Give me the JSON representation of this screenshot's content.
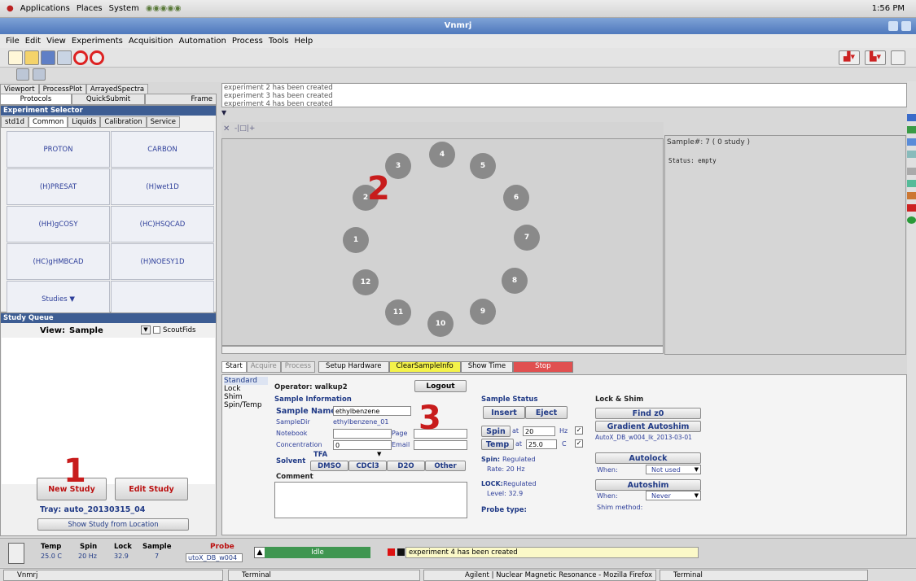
{
  "gnome": {
    "apps": "Applications",
    "places": "Places",
    "system": "System",
    "clock": "1:56 PM"
  },
  "window": {
    "title": "Vnmrj"
  },
  "menu": [
    "File",
    "Edit",
    "View",
    "Experiments",
    "Acquisition",
    "Automation",
    "Process",
    "Tools",
    "Help"
  ],
  "leftTabs": {
    "viewport": "Viewport",
    "processPlot": "ProcessPlot",
    "arrayedSpectra": "ArrayedSpectra",
    "protocols": "Protocols",
    "quickSubmit": "QuickSubmit",
    "frame": "Frame"
  },
  "expSelector": {
    "title": "Experiment Selector",
    "tabs": [
      "std1d",
      "Common",
      "Liquids",
      "Calibration",
      "Service"
    ],
    "cells": [
      "PROTON",
      "CARBON",
      "(H)PRESAT",
      "(H)wet1D",
      "(HH)gCOSY",
      "(HC)HSQCAD",
      "(HC)gHMBCAD",
      "(H)NOESY1D",
      "Studies ▼",
      ""
    ]
  },
  "studyQueue": {
    "title": "Study Queue",
    "viewLabel": "View:",
    "viewValue": "Sample",
    "scoutFids": "ScoutFids",
    "newStudy": "New Study",
    "editStudy": "Edit Study",
    "tray": "Tray: auto_20130315_04",
    "showStudy": "Show Study from Location"
  },
  "messages": [
    "experiment 2 has been created",
    "experiment 3 has been created",
    "experiment 4 has been created"
  ],
  "carousel": {
    "samples": [
      "4",
      "5",
      "6",
      "7",
      "8",
      "9",
      "10",
      "11",
      "12",
      "1",
      "2",
      "3"
    ]
  },
  "sampleInfo": {
    "header": "Sample#: 7   ( 0 study )",
    "status": "Status:  empty"
  },
  "bottomTabs": {
    "start": "Start",
    "acquire": "Acquire",
    "process": "Process",
    "setupHardware": "Setup Hardware",
    "clearSample": "ClearSampleInfo",
    "showTime": "Show Time",
    "stop": "Stop"
  },
  "sideMenu": [
    "Standard",
    "Lock",
    "Shim",
    "Spin/Temp"
  ],
  "operator": {
    "label": "Operator: walkup2",
    "logout": "Logout"
  },
  "sample": {
    "header": "Sample Information",
    "nameLabel": "Sample Name",
    "name": "ethylbenzene",
    "dirLabel": "SampleDir",
    "dir": "ethylbenzene_01",
    "notebookLabel": "Notebook",
    "pageLabel": "Page",
    "concLabel": "Concentration",
    "conc": "0",
    "emailLabel": "Email",
    "solventLabel": "Solvent",
    "solvent": "TFA",
    "solvents": [
      "DMSO",
      "CDCl3",
      "D2O",
      "Other"
    ],
    "commentLabel": "Comment"
  },
  "status": {
    "header": "Sample Status",
    "insert": "Insert",
    "eject": "Eject",
    "spin": "Spin",
    "at": "at",
    "spinVal": "20",
    "hz": "Hz",
    "temp": "Temp",
    "tempVal": "25.0",
    "c": "C",
    "spinLabel": "Spin:",
    "spinState": "Regulated",
    "rate": "Rate:  20 Hz",
    "lockLabel": "LOCK:",
    "lockState": "Regulated",
    "level": "Level:  32.9",
    "probeType": "Probe type:"
  },
  "lockShim": {
    "header": "Lock & Shim",
    "findZ0": "Find z0",
    "gradient": "Gradient Autoshim",
    "gradientFile": "AutoX_DB_w004_lk_2013-03-01",
    "autolock": "Autolock",
    "when": "When:",
    "autolockWhen": "Not used",
    "autoshim": "Autoshim",
    "autoshimWhen": "Never",
    "shimMethod": "Shim method:"
  },
  "statusBar": {
    "tempLabel": "Temp",
    "tempVal": "25.0 C",
    "spinLabel": "Spin",
    "spinVal": "20 Hz",
    "lockLabel": "Lock",
    "lockVal": "32.9",
    "sampleLabel": "Sample",
    "sampleVal": "7",
    "probeLabel": "Probe",
    "probeVal": "utoX_DB_w004",
    "idle": "Idle",
    "message": "experiment 4 has been created"
  },
  "taskbar": [
    "Vnmrj",
    "Terminal",
    "Agilent | Nuclear Magnetic Resonance - Mozilla Firefox",
    "Terminal"
  ],
  "annotations": [
    "1",
    "2",
    "3"
  ]
}
